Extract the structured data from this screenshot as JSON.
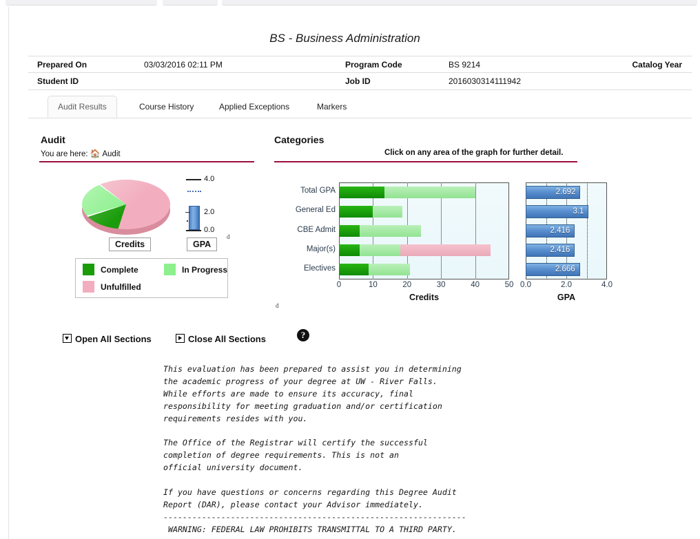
{
  "window": {
    "top_strip_note": "partially visible browser tab strip"
  },
  "document": {
    "title": "BS - Business Administration"
  },
  "header": {
    "rows": [
      {
        "label1": "Prepared On",
        "value1": "03/03/2016 02:11 PM",
        "label2": "Program Code",
        "value2": "BS 9214",
        "label3": "Catalog Year"
      },
      {
        "label1": "Student ID",
        "value1": "",
        "label2": "Job ID",
        "value2": "2016030314111942",
        "label3": ""
      }
    ]
  },
  "tabs": [
    {
      "label": "Audit Results",
      "active": true
    },
    {
      "label": "Course History",
      "active": false
    },
    {
      "label": "Applied Exceptions",
      "active": false
    },
    {
      "label": "Markers",
      "active": false
    }
  ],
  "audit_panel": {
    "heading": "Audit",
    "breadcrumb_prefix": "You are here:",
    "breadcrumb_home_icon": "home-icon",
    "breadcrumb_current": "Audit",
    "credits_caption": "Credits",
    "gpa_caption": "GPA",
    "legend": [
      {
        "label": "Complete",
        "color": "#1a9c0a"
      },
      {
        "label": "In Progress",
        "color": "#8df08d"
      },
      {
        "label": "Unfulfilled",
        "color": "#f2aebe"
      }
    ],
    "thermometer": {
      "top_label": "4.0",
      "mid_label": "2.0",
      "bottom_label": "0.0",
      "value": 2.692,
      "max": 4.0
    },
    "artifact_glyphs": [
      "d",
      "d"
    ]
  },
  "categories_panel": {
    "heading": "Categories",
    "hint": "Click on any area of the graph for further detail."
  },
  "actions": {
    "open_all": "Open All Sections",
    "close_all": "Close All Sections",
    "help_icon": "help-question-icon",
    "help_glyph": "?"
  },
  "disclaimer": "This evaluation has been prepared to assist you in determining\nthe academic progress of your degree at UW - River Falls.\nWhile efforts are made to ensure its accuracy, final\nresponsibility for meeting graduation and/or certification\nrequirements resides with you.\n\nThe Office of the Registrar will certify the successful\ncompletion of degree requirements. This is not an\nofficial university document.\n\nIf you have questions or concerns regarding this Degree Audit\nReport (DAR), please contact your Advisor immediately.\n---------------------------------------------------------------\n WARNING: FEDERAL LAW PROHIBITS TRANSMITTAL TO A THIRD PARTY.",
  "colors": {
    "accent_rule": "#9c0f3e",
    "complete": "#1a9c0a",
    "in_progress": "#8df08d",
    "unfulfilled": "#f2aebe",
    "gpa_bar": "#5a90cf",
    "plot_bg": "#eaf7fb"
  },
  "chart_data": [
    {
      "type": "pie",
      "title": "Credits",
      "labels": [
        "Unfulfilled",
        "Complete",
        "In Progress"
      ],
      "values": [
        69.4,
        15.0,
        15.6
      ],
      "colors": [
        "#f2aebe",
        "#1a9c0a",
        "#8df08d"
      ],
      "legend_position": "below",
      "three_d": true
    },
    {
      "type": "bar",
      "orientation": "horizontal",
      "title": "",
      "xlabel": "Credits",
      "ylabel": "",
      "xlim": [
        0,
        50
      ],
      "xticks": [
        0,
        10,
        20,
        30,
        40,
        50
      ],
      "grid": true,
      "categories": [
        "Total GPA",
        "General Ed",
        "CBE Admit",
        "Major(s)",
        "Electives"
      ],
      "stacked": true,
      "series": [
        {
          "name": "Complete",
          "color": "#1a9c0a",
          "values": [
            13.4,
            10.0,
            6.1,
            6.0,
            8.8
          ]
        },
        {
          "name": "In Progress",
          "color": "#8df08d",
          "values": [
            26.6,
            8.6,
            18.0,
            12.0,
            12.0
          ]
        },
        {
          "name": "Unfulfilled",
          "color": "#f2aebe",
          "values": [
            0,
            0,
            0,
            26.6,
            0
          ]
        }
      ],
      "totals": [
        40.0,
        18.6,
        24.1,
        44.6,
        20.8
      ]
    },
    {
      "type": "bar",
      "orientation": "horizontal",
      "title": "",
      "xlabel": "GPA",
      "ylabel": "",
      "xlim": [
        0,
        4.0
      ],
      "xticks": [
        "0.0",
        "2.0",
        "4.0"
      ],
      "gridlines_solid": [
        2.0
      ],
      "gridlines_dotted": [
        1.0,
        3.0
      ],
      "categories": [
        "Total GPA",
        "General Ed",
        "CBE Admit",
        "Major(s)",
        "Electives"
      ],
      "values": [
        2.692,
        3.1,
        2.416,
        2.416,
        2.666
      ],
      "value_labels": [
        "2.692",
        "3.1",
        "2.416",
        "2.416",
        "2.666"
      ],
      "bar_color": "#5a90cf"
    }
  ]
}
